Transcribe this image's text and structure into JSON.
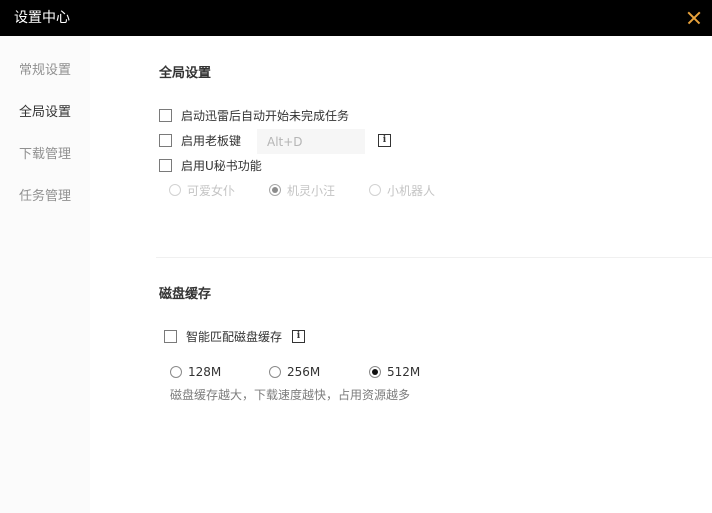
{
  "window": {
    "title": "设置中心"
  },
  "sidebar": {
    "items": [
      {
        "label": "常规设置",
        "active": false
      },
      {
        "label": "全局设置",
        "active": true
      },
      {
        "label": "下载管理",
        "active": false
      },
      {
        "label": "任务管理",
        "active": false
      }
    ]
  },
  "global": {
    "heading": "全局设置",
    "auto_start": {
      "label": "启动迅雷后自动开始未完成任务",
      "checked": false
    },
    "boss_key": {
      "label": "启用老板键",
      "checked": false,
      "hotkey": "Alt+D",
      "info_icon": "info-icon"
    },
    "u_secretary": {
      "label": "启用U秘书功能",
      "checked": false,
      "options": [
        "可爱女仆",
        "机灵小汪",
        "小机器人"
      ],
      "selected": "机灵小汪"
    }
  },
  "disk_cache": {
    "heading": "磁盘缓存",
    "smart_match": {
      "label": "智能匹配磁盘缓存",
      "checked": false,
      "info_icon": "info-icon"
    },
    "options": [
      "128M",
      "256M",
      "512M"
    ],
    "selected": "512M",
    "note": "磁盘缓存越大，下载速度越快，占用资源越多"
  },
  "colors": {
    "titlebar": "#000000",
    "close_icon": "#e8a23c",
    "sidebar_bg": "#fbfbfb"
  }
}
